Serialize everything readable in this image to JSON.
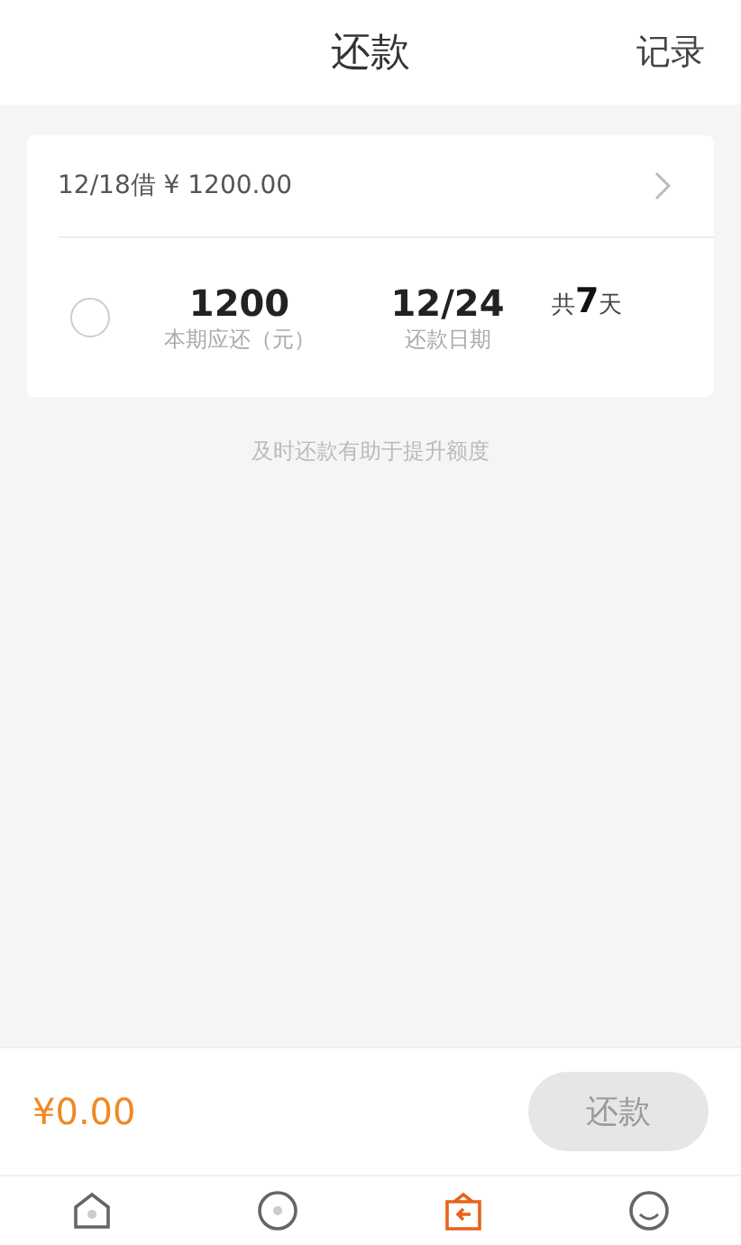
{
  "header": {
    "title": "还款",
    "record_link": "记录"
  },
  "loan": {
    "summary": "12/18借 ¥ 1200.00",
    "selected": false,
    "amount": "1200",
    "amount_label": "本期应还（元）",
    "date": "12/24",
    "date_label": "还款日期",
    "duration": "共**7**天"
  },
  "hint": "及时还款有助于提升额度",
  "footer": {
    "total": "¥0.00",
    "pay_button": "还款",
    "disabled": true
  },
  "tabs": [
    {
      "kind": "home",
      "selected": false
    },
    {
      "kind": "coin",
      "selected": false
    },
    {
      "kind": "repay",
      "selected": true
    },
    {
      "kind": "profile",
      "selected": false
    }
  ]
}
